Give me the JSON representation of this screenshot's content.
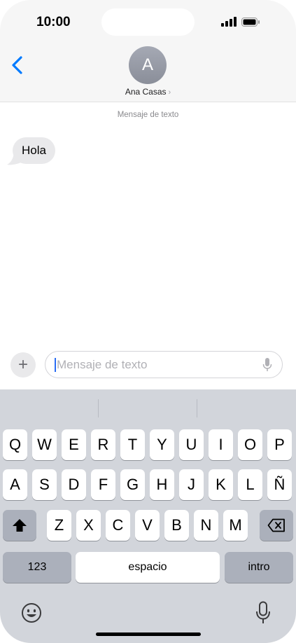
{
  "status": {
    "time": "10:00"
  },
  "header": {
    "avatar_initial": "A",
    "contact_name": "Ana Casas",
    "chevron": "›"
  },
  "thread": {
    "service_label": "Mensaje de texto",
    "messages": [
      {
        "text": "Hola",
        "direction": "incoming"
      }
    ]
  },
  "composer": {
    "placeholder": "Mensaje de texto",
    "plus_symbol": "+"
  },
  "keyboard": {
    "row1": [
      "Q",
      "W",
      "E",
      "R",
      "T",
      "Y",
      "U",
      "I",
      "O",
      "P"
    ],
    "row2": [
      "A",
      "S",
      "D",
      "F",
      "G",
      "H",
      "J",
      "K",
      "L",
      "Ñ"
    ],
    "row3": [
      "Z",
      "X",
      "C",
      "V",
      "B",
      "N",
      "M"
    ],
    "numbers_label": "123",
    "space_label": "espacio",
    "return_label": "intro"
  },
  "icons": [
    "signal-icon",
    "battery-icon",
    "back-chevron-icon",
    "mic-icon",
    "shift-icon",
    "delete-icon",
    "emoji-icon",
    "dictation-icon"
  ],
  "colors": {
    "accent": "#007aff",
    "bubble": "#e9e9eb",
    "keyboard": "#d2d5db"
  }
}
